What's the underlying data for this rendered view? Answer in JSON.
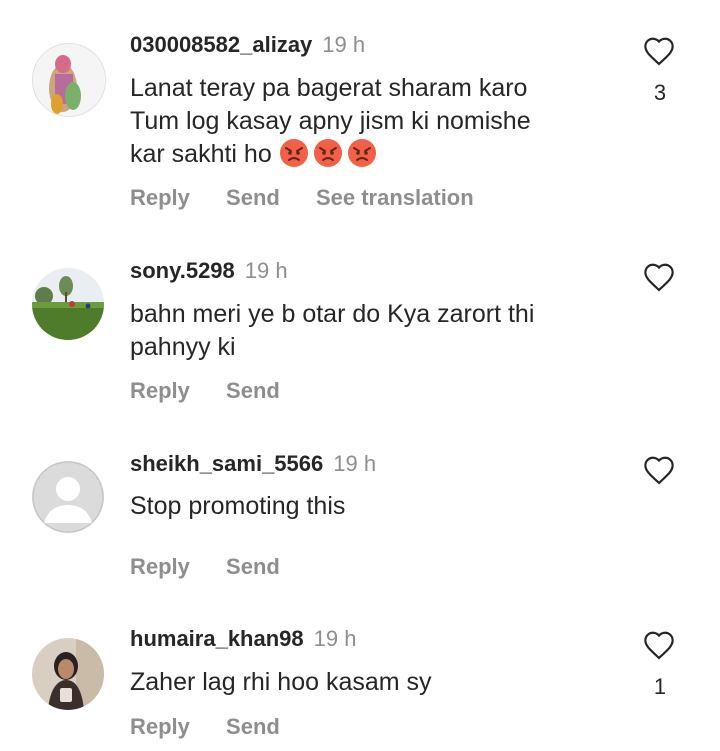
{
  "comments": [
    {
      "username": "030008582_alizay",
      "time": "19 h",
      "text_lines": [
        "Lanat teray pa bagerat sharam karo",
        "Tum log kasay apny jism ki nomishe",
        "kar sakhti ho"
      ],
      "emojis": [
        "angry-face-icon",
        "angry-face-icon",
        "angry-face-icon"
      ],
      "actions": [
        "Reply",
        "Send",
        "See translation"
      ],
      "likes": "3"
    },
    {
      "username": "sony.5298",
      "time": "19 h",
      "text_lines": [
        "bahn meri ye b otar do Kya zarort thi",
        "pahnyy ki"
      ],
      "actions": [
        "Reply",
        "Send"
      ],
      "likes": ""
    },
    {
      "username": "sheikh_sami_5566",
      "time": "19 h",
      "text_lines": [
        "Stop promoting this"
      ],
      "actions": [
        "Reply",
        "Send"
      ],
      "likes": ""
    },
    {
      "username": "humaira_khan98",
      "time": "19 h",
      "text_lines": [
        "Zaher lag rhi hoo kasam sy"
      ],
      "actions": [
        "Reply",
        "Send"
      ],
      "likes": "1"
    }
  ],
  "colors": {
    "text": "#262626",
    "muted": "#8e8e8e",
    "emoji_red": "#e8433c",
    "emoji_face": "#ff7a52"
  }
}
